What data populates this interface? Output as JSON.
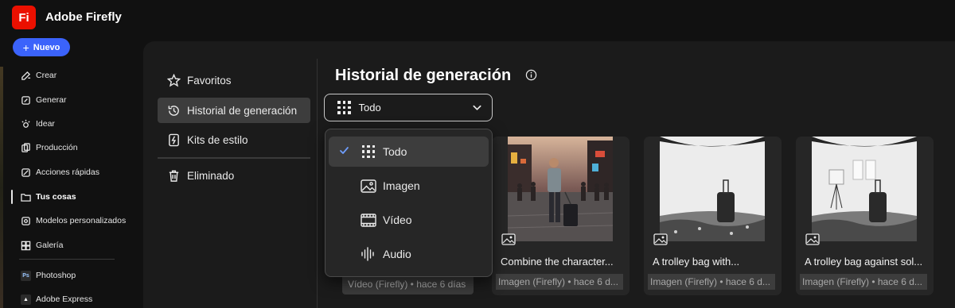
{
  "app": {
    "logo_text": "Fi",
    "title": "Adobe Firefly",
    "brand_color": "#eb1000"
  },
  "new_button": {
    "label": "Nuevo",
    "icon": "plus-icon"
  },
  "sidebar": {
    "items": [
      {
        "label": "Crear",
        "icon": "create-icon"
      },
      {
        "label": "Generar",
        "icon": "generate-icon"
      },
      {
        "label": "Idear",
        "icon": "ideate-icon"
      },
      {
        "label": "Producción",
        "icon": "production-icon"
      },
      {
        "label": "Acciones rápidas",
        "icon": "quick-actions-icon"
      },
      {
        "label": "Tus cosas",
        "icon": "folder-icon",
        "active": true
      },
      {
        "label": "Modelos personalizados",
        "icon": "custom-models-icon"
      },
      {
        "label": "Galería",
        "icon": "gallery-icon"
      }
    ],
    "apps": [
      {
        "label": "Photoshop",
        "badge": "Ps"
      },
      {
        "label": "Adobe Express",
        "badge": "Ae"
      }
    ]
  },
  "subnav": {
    "items": [
      {
        "label": "Favoritos",
        "icon": "star-icon"
      },
      {
        "label": "Historial de generación",
        "icon": "history-icon",
        "selected": true
      },
      {
        "label": "Kits de estilo",
        "icon": "style-kit-icon"
      },
      {
        "label": "Eliminado",
        "icon": "trash-icon"
      }
    ]
  },
  "main": {
    "title": "Historial de generación",
    "filter": {
      "value": "Todo"
    }
  },
  "dropdown": {
    "options": [
      {
        "label": "Todo",
        "icon": "grid-icon",
        "selected": true
      },
      {
        "label": "Imagen",
        "icon": "image-icon"
      },
      {
        "label": "Vídeo",
        "icon": "video-icon"
      },
      {
        "label": "Audio",
        "icon": "audio-icon"
      }
    ]
  },
  "cards": [
    {
      "caption": "",
      "meta": "Vídeo (Firefly) • hace 6 días"
    },
    {
      "caption": "Combine the character...",
      "meta": "Imagen (Firefly) • hace 6 d..."
    },
    {
      "caption": "A trolley bag with...",
      "meta": "Imagen (Firefly) • hace 6 d..."
    },
    {
      "caption": "A trolley bag against sol...",
      "meta": "Imagen (Firefly) • hace 6 d..."
    }
  ]
}
